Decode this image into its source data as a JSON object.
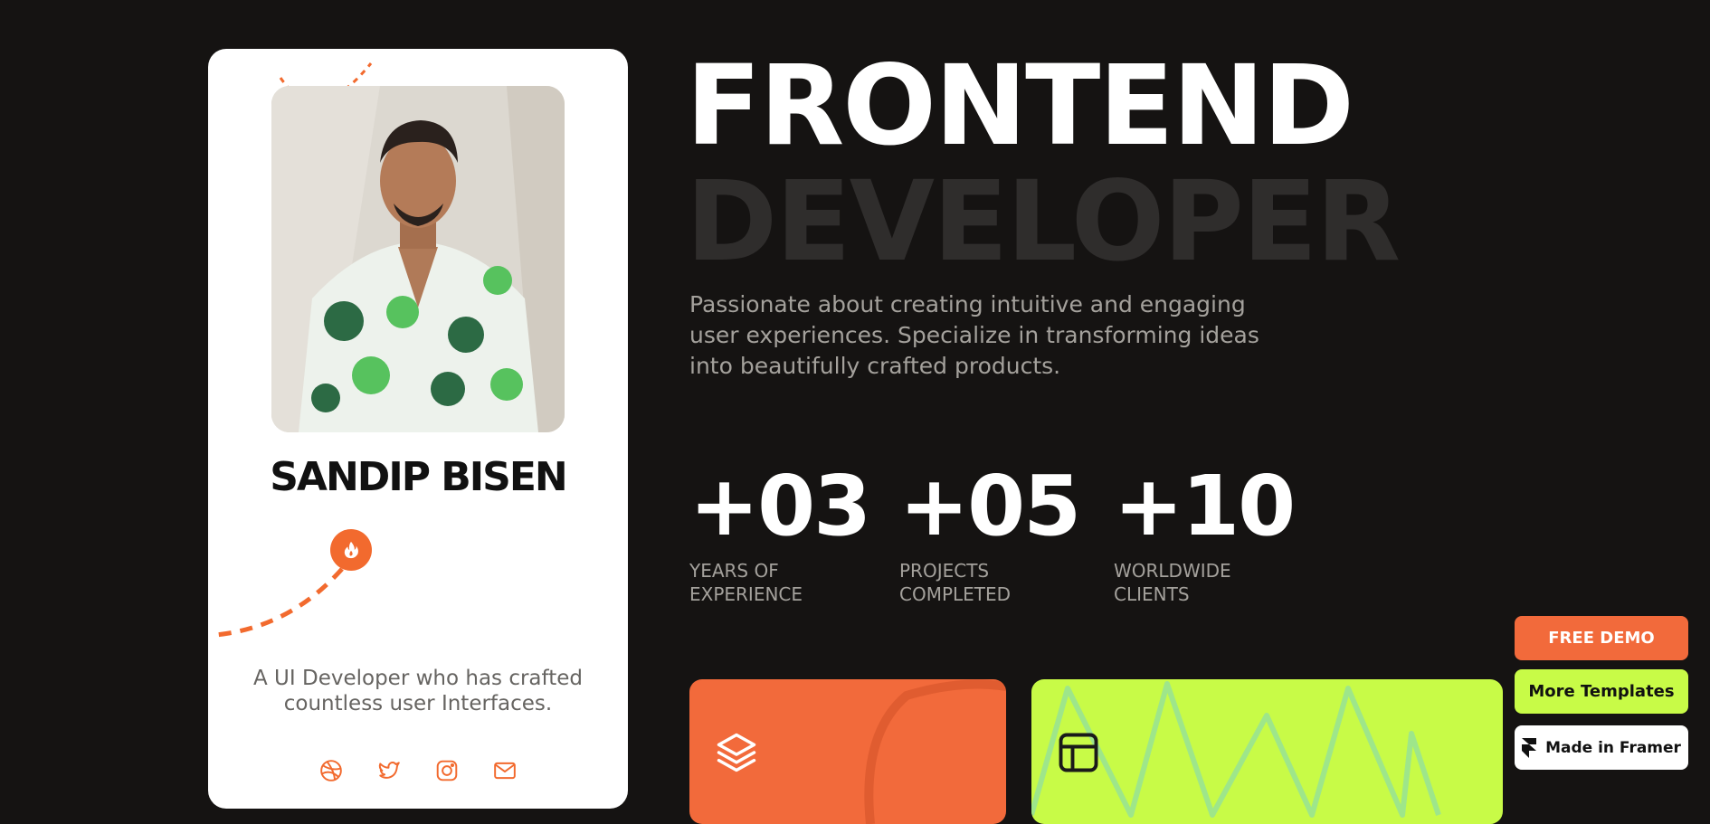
{
  "profile": {
    "name": "SANDIP BISEN",
    "tagline": "A UI Developer who has crafted countless user Interfaces.",
    "social_icons": [
      "dribbble-icon",
      "twitter-icon",
      "instagram-icon",
      "mail-icon"
    ]
  },
  "hero": {
    "title_line1": "FRONTEND",
    "title_line2": "DEVELOPER",
    "intro": "Passionate about creating intuitive and engaging user experiences. Specialize in transforming ideas into beautifully crafted products."
  },
  "stats": [
    {
      "value": "+03",
      "label": "YEARS OF\nEXPERIENCE"
    },
    {
      "value": "+05",
      "label": "PROJECTS\nCOMPLETED"
    },
    {
      "value": "+10",
      "label": "WORLDWIDE\nCLIENTS"
    }
  ],
  "feature_cards": [
    {
      "icon": "layers-icon",
      "color": "#f26a3b"
    },
    {
      "icon": "layout-icon",
      "color": "#c8fb47"
    }
  ],
  "floating_buttons": {
    "demo_label": "FREE DEMO",
    "templates_label": "More Templates",
    "framer_label": "Made in Framer"
  },
  "colors": {
    "background": "#151312",
    "accent_orange": "#f26a3b",
    "accent_lime": "#c8fb47",
    "text_muted": "#a4a19c"
  }
}
